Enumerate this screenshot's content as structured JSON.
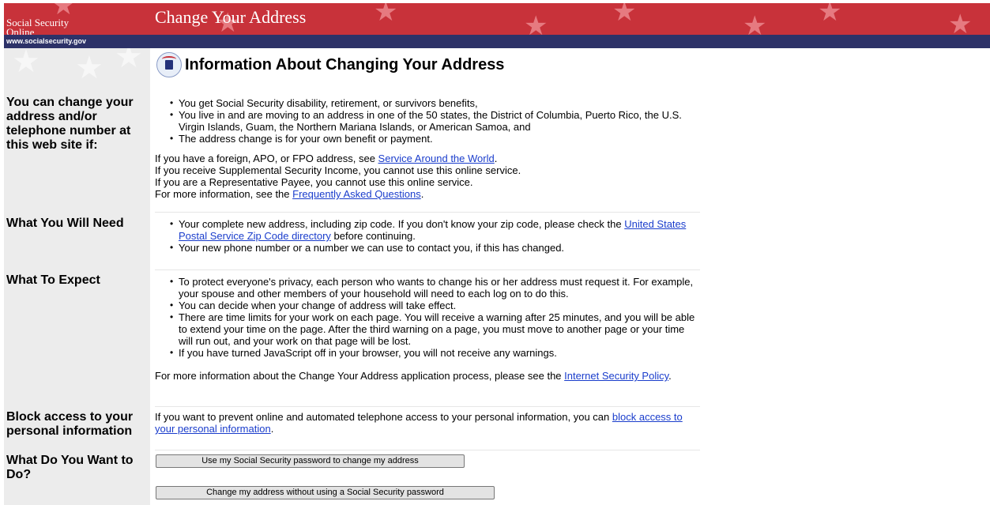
{
  "header": {
    "brand_line1": "Social Security",
    "brand_line2": "Online",
    "title": "Change Your Address",
    "site_url": "www.socialsecurity.gov"
  },
  "main": {
    "heading": "Information About Changing Your Address",
    "eligibility": {
      "label": "You can change your address and/or telephone number at this web site if:",
      "bullets": [
        "You get Social Security disability, retirement, or survivors benefits,",
        "You live in and are moving to an address in one of the 50 states, the District of Columbia, Puerto Rico, the U.S. Virgin Islands, Guam, the Northern Mariana Islands, or American Samoa, and",
        "The address change is for your own benefit or payment."
      ],
      "foreign_prefix": "If you have a foreign, APO, or FPO address, see ",
      "foreign_link": "Service Around the World",
      "foreign_suffix": ".",
      "ssi_note": "If you receive Supplemental Security Income, you cannot use this online service.",
      "payee_note": "If you are a Representative Payee, you cannot use this online service.",
      "faq_prefix": "For more information, see the ",
      "faq_link": "Frequently Asked Questions",
      "faq_suffix": "."
    },
    "need": {
      "label": "What You Will Need",
      "b1_prefix": "Your complete new address, including zip code. If you don't know your zip code, please check the ",
      "b1_link": "United States Postal Service Zip Code directory",
      "b1_suffix": " before continuing.",
      "b2": "Your new phone number or a number we can use to contact you, if this has changed."
    },
    "expect": {
      "label": "What To Expect",
      "bullets": [
        "To protect everyone's privacy, each person who wants to change his or her address must request it. For example, your spouse and other members of your household will need to each log on to do this.",
        "You can decide when your change of address will take effect.",
        "There are time limits for your work on each page. You will receive a warning after 25 minutes, and you will be able to extend your time on the page. After the third warning on a page, you must move to another page or your time will run out, and your work on that page will be lost.",
        "If you have turned JavaScript off in your browser, you will not receive any warnings."
      ],
      "more_prefix": "For more information about the Change Your Address application process, please see the ",
      "more_link": "Internet Security Policy",
      "more_suffix": "."
    },
    "block": {
      "label": "Block access to your personal information",
      "text_prefix": "If you want to prevent online and automated telephone access to your personal information, you can ",
      "link": "block access to your personal information",
      "suffix": "."
    },
    "todo": {
      "label": "What Do You Want to Do?",
      "btn_password": "Use my Social Security password to change my address",
      "btn_no_password": "Change my address without using a Social Security password"
    }
  },
  "colors": {
    "banner_red": "#c8323a",
    "navbar_navy": "#2d3268",
    "sidebar_gray": "#ececec",
    "link_blue": "#1a3dcc"
  }
}
